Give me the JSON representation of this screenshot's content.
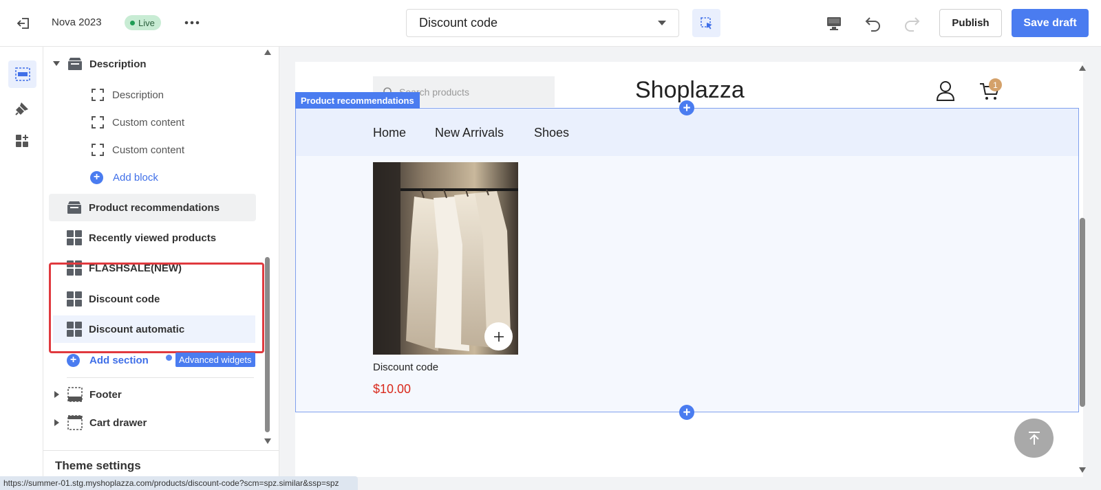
{
  "topbar": {
    "theme_name": "Nova 2023",
    "live_label": "Live",
    "page_select_value": "Discount code",
    "publish_label": "Publish",
    "save_draft_label": "Save draft"
  },
  "sidebar": {
    "description_group": {
      "label": "Description",
      "blocks": [
        "Description",
        "Custom content",
        "Custom content"
      ],
      "add_block_label": "Add block"
    },
    "sections": [
      {
        "label": "Product recommendations",
        "icon": "section-box-icon"
      },
      {
        "label": "Recently viewed products",
        "icon": "grid-icon"
      },
      {
        "label": "FLASHSALE(NEW)",
        "icon": "grid-icon"
      },
      {
        "label": "Discount code",
        "icon": "grid-icon"
      },
      {
        "label": "Discount automatic",
        "icon": "grid-icon"
      }
    ],
    "add_section_label": "Add section",
    "advanced_widgets_label": "Advanced widgets",
    "footer_label": "Footer",
    "cart_drawer_label": "Cart drawer",
    "theme_settings_label": "Theme settings"
  },
  "preview": {
    "search_placeholder": "Search products",
    "logo": "Shoplazza",
    "cart_count": "1",
    "selected_section_tag": "Product recommendations",
    "nav_items": [
      "Home",
      "New Arrivals",
      "Shoes"
    ],
    "product": {
      "title": "Discount code",
      "price": "$10.00"
    }
  },
  "status_url": "https://summer-01.stg.myshoplazza.com/products/discount-code?scm=spz.similar&ssp=spz",
  "colors": {
    "accent": "#4a7cf0",
    "price": "#d9291c",
    "highlight": "#e0393e",
    "live_bg": "#c8ecd4"
  }
}
